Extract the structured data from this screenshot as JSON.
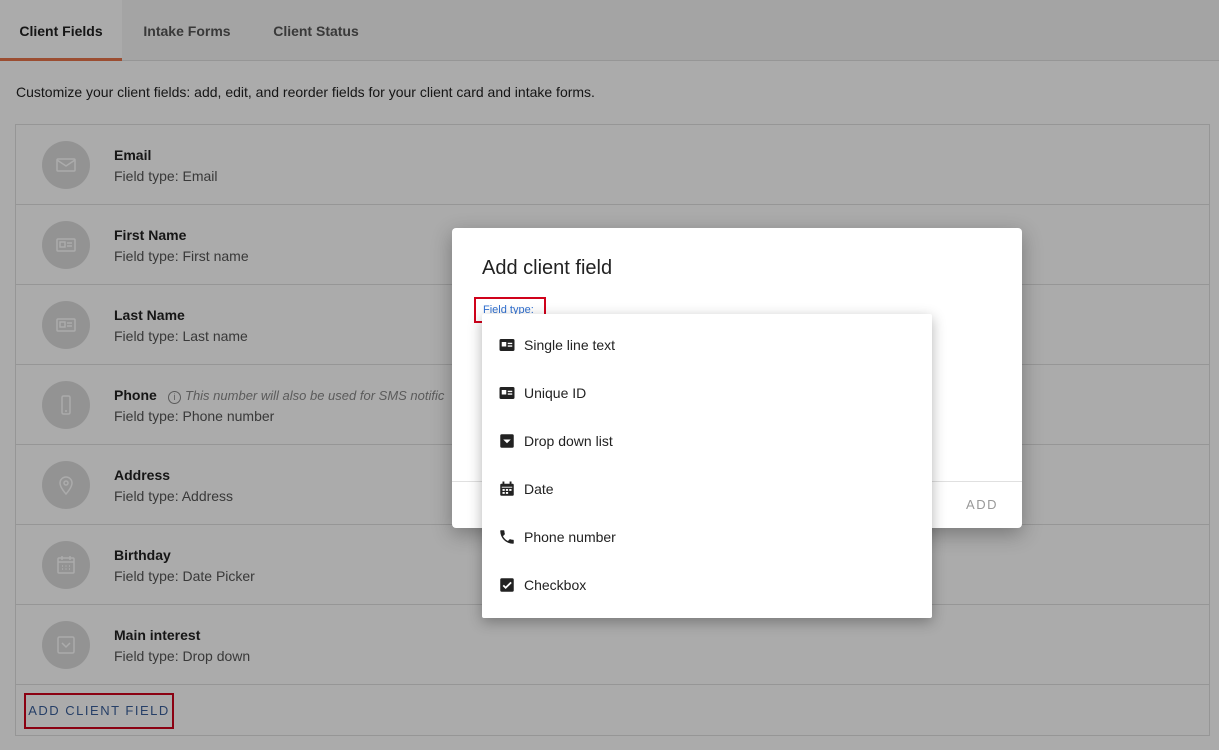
{
  "tabs": [
    {
      "label": "Client Fields"
    },
    {
      "label": "Intake Forms"
    },
    {
      "label": "Client Status"
    }
  ],
  "description": "Customize your client fields: add, edit, and reorder fields for your client card and intake forms.",
  "fields": [
    {
      "label": "Email",
      "type": "Field type: Email",
      "icon": "envelope-icon"
    },
    {
      "label": "First Name",
      "type": "Field type: First name",
      "icon": "id-card-icon"
    },
    {
      "label": "Last Name",
      "type": "Field type: Last name",
      "icon": "id-card-icon"
    },
    {
      "label": "Phone",
      "type": "Field type: Phone number",
      "icon": "mobile-phone-icon",
      "note": "This number will also be used for SMS notific"
    },
    {
      "label": "Address",
      "type": "Field type: Address",
      "icon": "location-pin-icon"
    },
    {
      "label": "Birthday",
      "type": "Field type: Date Picker",
      "icon": "calendar-icon"
    },
    {
      "label": "Main interest",
      "type": "Field type: Drop down",
      "icon": "dropdown-box-icon"
    }
  ],
  "footer": {
    "add_client_field_label": "ADD CLIENT FIELD"
  },
  "dialog": {
    "title": "Add client field",
    "field_type_label": "Field type:",
    "add_label": "ADD"
  },
  "menu": {
    "items": [
      {
        "label": "Single line text",
        "icon": "id-card-icon"
      },
      {
        "label": "Unique ID",
        "icon": "id-card-icon"
      },
      {
        "label": "Drop down list",
        "icon": "dropdown-box-icon"
      },
      {
        "label": "Date",
        "icon": "calendar-icon"
      },
      {
        "label": "Phone number",
        "icon": "phone-handset-icon"
      },
      {
        "label": "Checkbox",
        "icon": "checkbox-checked-icon"
      }
    ]
  },
  "colors": {
    "accent_tab": "#e8744a",
    "highlight_border": "#d0021b",
    "link_blue": "#3a5f9a",
    "label_blue": "#2f6fd0"
  }
}
